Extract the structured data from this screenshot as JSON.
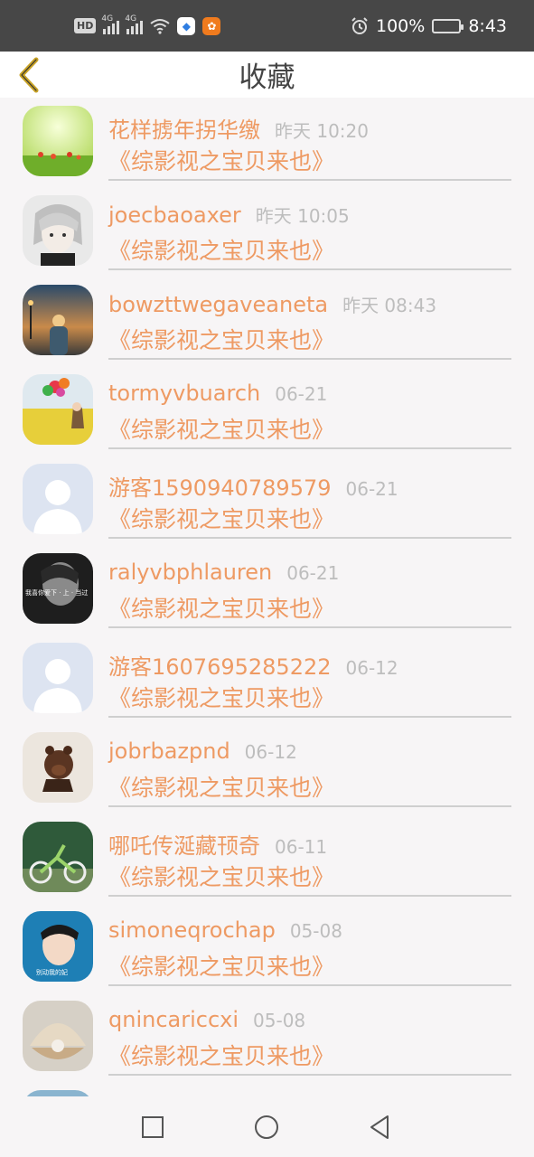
{
  "status_bar": {
    "hd": "HD",
    "network1": "4G",
    "network2": "4G",
    "battery": "100%",
    "time": "8:43"
  },
  "header": {
    "title": "收藏"
  },
  "items": [
    {
      "name": "花样掳年拐华缴",
      "time": "昨天 10:20",
      "work": "《综影视之宝贝来也》"
    },
    {
      "name": "joecbaoaxer",
      "time": "昨天 10:05",
      "work": "《综影视之宝贝来也》"
    },
    {
      "name": "bowzttwegaveaneta",
      "time": "昨天 08:43",
      "work": "《综影视之宝贝来也》"
    },
    {
      "name": "tormyvbuarch",
      "time": "06-21",
      "work": "《综影视之宝贝来也》"
    },
    {
      "name": "游客1590940789579",
      "time": "06-21",
      "work": "《综影视之宝贝来也》"
    },
    {
      "name": "ralyvbphlauren",
      "time": "06-21",
      "work": "《综影视之宝贝来也》"
    },
    {
      "name": "游客1607695285222",
      "time": "06-12",
      "work": "《综影视之宝贝来也》"
    },
    {
      "name": "jobrbazpnd",
      "time": "06-12",
      "work": "《综影视之宝贝来也》"
    },
    {
      "name": "哪吒传涎藏顸奇",
      "time": "06-11",
      "work": "《综影视之宝贝来也》"
    },
    {
      "name": "simoneqrochap",
      "time": "05-08",
      "work": "《综影视之宝贝来也》"
    },
    {
      "name": "qnincariccxi",
      "time": "05-08",
      "work": "《综影视之宝贝来也》"
    }
  ],
  "avatar_overlays": {
    "item6": "我喜你爱下 · 上 · 当过",
    "item10": "别动我的妃"
  },
  "colors": {
    "accent": "#ee9a63",
    "muted": "#bdbdbd",
    "status_bar_bg": "#474747",
    "back_arrow": "#c8a226"
  }
}
